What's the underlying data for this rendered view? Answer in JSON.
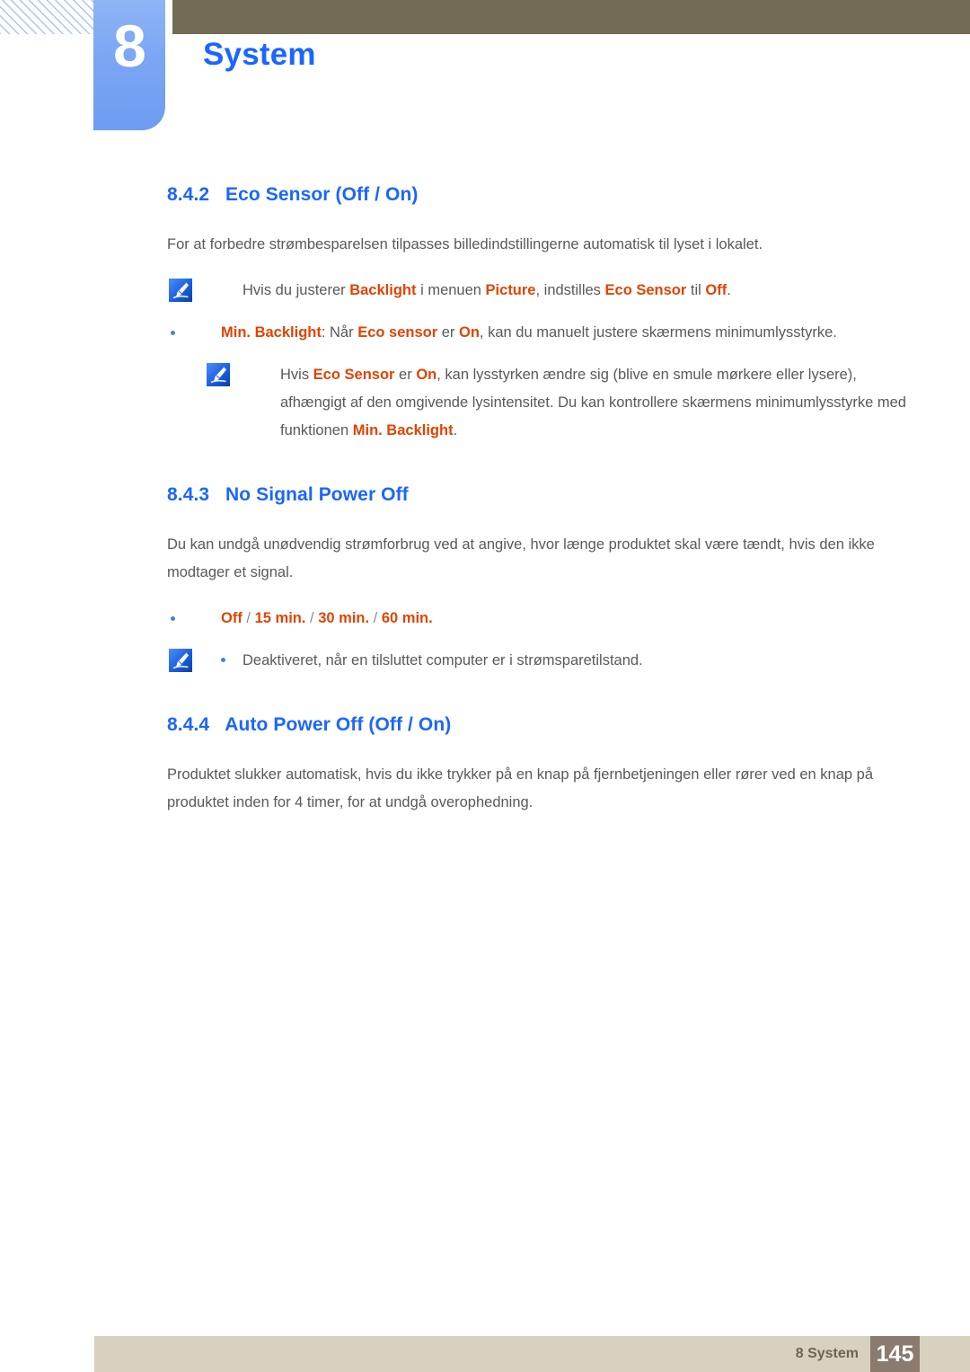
{
  "header": {
    "chapter_number": "8",
    "chapter_title": "System",
    "olive_bar_color": "#716c53",
    "badge_color": "#7aa6f3",
    "title_color": "#1a66ff"
  },
  "sections": [
    {
      "number": "8.4.2",
      "title": "Eco Sensor (Off / On)",
      "intro": "For at forbedre strømbesparelsen tilpasses billedindstillingerne automatisk til lyset i lokalet."
    },
    {
      "number": "8.4.3",
      "title": "No Signal Power Off",
      "intro": "Du kan undgå unødvendig strømforbrug ved at angive, hvor længe produktet skal være tændt, hvis den ikke modtager et signal."
    },
    {
      "number": "8.4.4",
      "title": "Auto Power Off (Off / On)",
      "intro": "Produktet slukker automatisk, hvis du ikke trykker på en knap på fjernbetjeningen eller rører ved en knap på produktet inden for 4 timer, for at undgå overophedning."
    }
  ],
  "notes": {
    "note1": {
      "icon": "note-pencil-icon",
      "pre": "Hvis du justerer ",
      "term1": "Backlight",
      "mid1": " i menuen ",
      "term2": "Picture",
      "mid2": ", indstilles ",
      "term3": "Eco Sensor",
      "mid3": " til ",
      "term4": "Off",
      "end": "."
    },
    "bullet1": {
      "term1": "Min. Backlight",
      "mid1": ": Når ",
      "term2": "Eco sensor",
      "mid2": " er ",
      "term3": "On",
      "end": ", kan du manuelt justere skærmens minimumlysstyrke."
    },
    "note2": {
      "icon": "note-pencil-icon",
      "pre": "Hvis ",
      "term1": "Eco Sensor",
      "mid1": " er ",
      "term2": "On",
      "mid2": ", kan lysstyrken ændre sig (blive en smule mørkere eller lysere), afhængigt af den omgivende lysintensitet. Du kan kontrollere skærmens minimumlysstyrke med funktionen ",
      "term3": "Min. Backlight",
      "end": "."
    },
    "options_bullet": {
      "opt1": "Off",
      "sep1": " / ",
      "opt2": "15 min.",
      "sep2": " / ",
      "opt3": "30 min.",
      "sep3": " / ",
      "opt4": "60 min."
    },
    "note3": {
      "icon": "note-pencil-icon",
      "text": "Deaktiveret, når en tilsluttet computer er i strømsparetilstand."
    }
  },
  "footer": {
    "label": "8 System",
    "page_number": "145",
    "bar_color": "#d8d1bf",
    "page_box_color": "#8a7b6e"
  },
  "colors": {
    "highlight": "#e04403",
    "heading": "#1a66ff",
    "body": "#58595b"
  }
}
